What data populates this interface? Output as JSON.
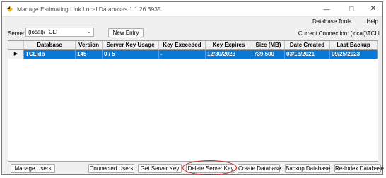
{
  "window": {
    "title": "Manage Estimating Link Local Databases 1.1.26.3935",
    "controls": {
      "minimize": "—",
      "maximize": "☐",
      "close": "✕"
    }
  },
  "menu": {
    "items": [
      "Database Tools",
      "Help"
    ]
  },
  "toolbar": {
    "server_label": "Server",
    "server_value": "(local)/TCLI",
    "new_entry_label": "New Entry",
    "current_connection": "Current Connection: (local)\\TCLI"
  },
  "grid": {
    "columns": [
      "Database",
      "Version",
      "Server Key Usage",
      "Key Exceeded",
      "Key Expires",
      "Size (MB)",
      "Date Created",
      "Last Backup"
    ],
    "rows": [
      {
        "selected": true,
        "cells": [
          "TCLidb",
          "145",
          "0 / 5",
          "-",
          "12/30/2023",
          "739.500",
          "03/18/2021",
          "09/25/2023"
        ]
      }
    ]
  },
  "buttons": {
    "manage_users": "Manage Users",
    "connected_users": "Connected Users",
    "get_server_key": "Get Server Key",
    "delete_server_key": "Delete Server Key",
    "create_database": "Create Database",
    "backup_database": "Backup Database",
    "reindex_database": "Re-Index Database"
  },
  "colors": {
    "selection": "#0a78d7",
    "highlight_ring": "#c42121",
    "app_icon": "#f2b705"
  }
}
